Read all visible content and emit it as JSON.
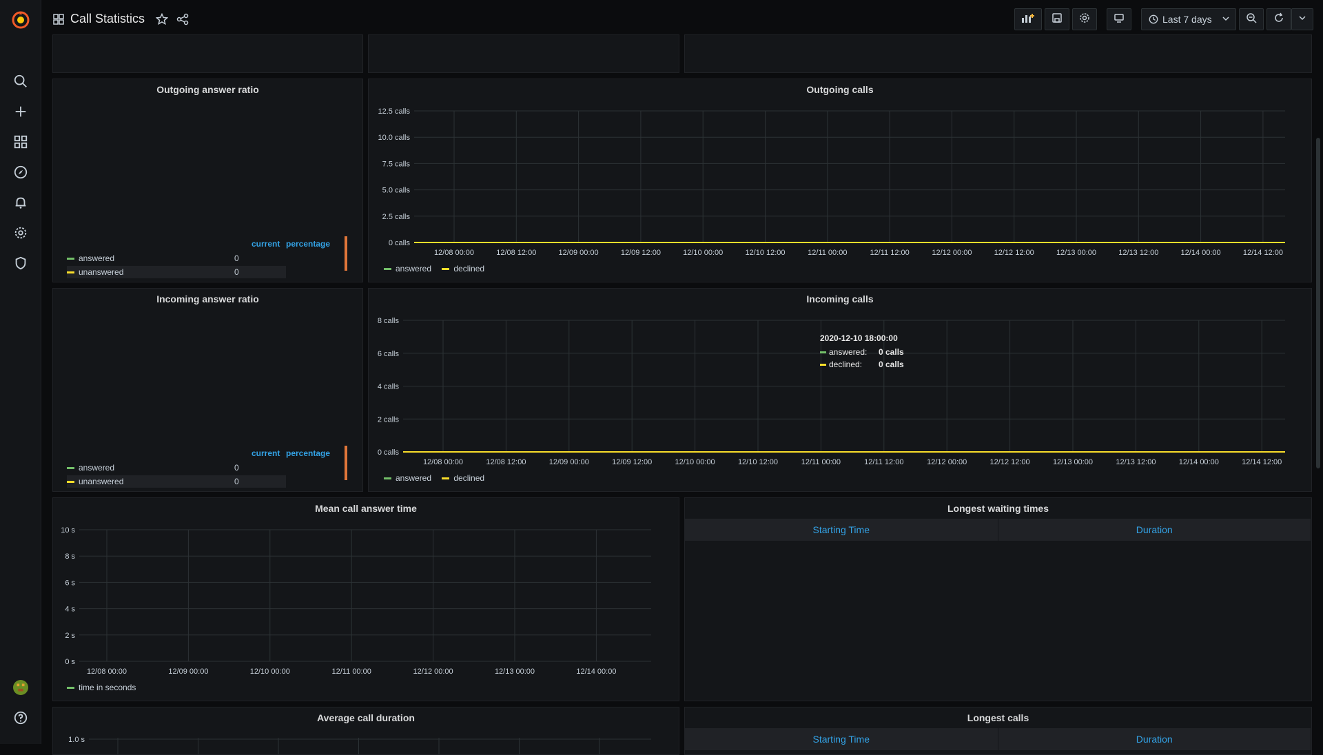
{
  "dashboard": {
    "title": "Call Statistics"
  },
  "topbar": {
    "time_range": "Last 7 days"
  },
  "colors": {
    "answered": "#73bf69",
    "declined": "#fade2a",
    "bar": "#e0763a",
    "accent": "#33a2e5"
  },
  "icons": {
    "sidemenu": [
      "grafana-logo",
      "search-icon",
      "plus-icon",
      "dashboards-icon",
      "explore-icon",
      "alerting-icon",
      "configuration-icon",
      "shield-icon",
      "user-avatar",
      "help-icon"
    ],
    "topbar": [
      "add-panel-icon",
      "save-icon",
      "settings-icon",
      "tv-mode-icon",
      "clock-icon",
      "zoom-out-icon",
      "refresh-icon",
      "chevron-down-icon"
    ]
  },
  "panels": {
    "outgoing_ratio": {
      "title": "Outgoing answer ratio",
      "columns": [
        "current",
        "percentage"
      ],
      "rows": [
        {
          "label": "answered",
          "current": "0"
        },
        {
          "label": "unanswered",
          "current": "0"
        }
      ]
    },
    "incoming_ratio": {
      "title": "Incoming answer ratio",
      "columns": [
        "current",
        "percentage"
      ],
      "rows": [
        {
          "label": "answered",
          "current": "0"
        },
        {
          "label": "unanswered",
          "current": "0"
        }
      ]
    },
    "longest_waiting": {
      "title": "Longest waiting times",
      "columns": [
        "Starting Time",
        "Duration"
      ]
    },
    "longest_calls": {
      "title": "Longest calls",
      "columns": [
        "Starting Time",
        "Duration"
      ]
    },
    "incoming_tooltip": {
      "time": "2020-12-10 18:00:00",
      "rows": [
        {
          "label": "answered:",
          "value": "0 calls"
        },
        {
          "label": "declined:",
          "value": "0 calls"
        }
      ]
    }
  },
  "chart_data": [
    {
      "id": "outgoing_calls",
      "type": "line",
      "title": "Outgoing calls",
      "x": [
        "12/08 00:00",
        "12/08 12:00",
        "12/09 00:00",
        "12/09 12:00",
        "12/10 00:00",
        "12/10 12:00",
        "12/11 00:00",
        "12/11 12:00",
        "12/12 00:00",
        "12/12 12:00",
        "12/13 00:00",
        "12/13 12:00",
        "12/14 00:00",
        "12/14 12:00"
      ],
      "y_ticks": [
        "0 calls",
        "2.5 calls",
        "5.0 calls",
        "7.5 calls",
        "10.0 calls",
        "12.5 calls"
      ],
      "ylim": [
        0,
        12.5
      ],
      "ylabel": "",
      "xlabel": "",
      "grid": true,
      "legend": "bottom-left",
      "series": [
        {
          "name": "answered",
          "values": [
            0,
            0,
            0,
            0,
            0,
            0,
            0,
            0,
            0,
            0,
            0,
            0,
            0,
            0
          ]
        },
        {
          "name": "declined",
          "values": [
            0,
            0,
            0,
            0,
            0,
            0,
            0,
            0,
            0,
            0,
            0,
            0,
            0,
            0
          ]
        }
      ]
    },
    {
      "id": "incoming_calls",
      "type": "line",
      "title": "Incoming calls",
      "x": [
        "12/08 00:00",
        "12/08 12:00",
        "12/09 00:00",
        "12/09 12:00",
        "12/10 00:00",
        "12/10 12:00",
        "12/11 00:00",
        "12/11 12:00",
        "12/12 00:00",
        "12/12 12:00",
        "12/13 00:00",
        "12/13 12:00",
        "12/14 00:00",
        "12/14 12:00"
      ],
      "y_ticks": [
        "0 calls",
        "2 calls",
        "4 calls",
        "6 calls",
        "8 calls"
      ],
      "ylim": [
        0,
        8
      ],
      "ylabel": "",
      "xlabel": "",
      "grid": true,
      "legend": "bottom-left",
      "series": [
        {
          "name": "answered",
          "values": [
            0,
            0,
            0,
            0,
            0,
            0,
            0,
            0,
            0,
            0,
            0,
            0,
            0,
            0
          ]
        },
        {
          "name": "declined",
          "values": [
            0,
            0,
            0,
            0,
            0,
            0,
            0,
            0,
            0,
            0,
            0,
            0,
            0,
            0
          ]
        }
      ]
    },
    {
      "id": "mean_answer_time",
      "type": "line",
      "title": "Mean call answer time",
      "x": [
        "12/08 00:00",
        "12/09 00:00",
        "12/10 00:00",
        "12/11 00:00",
        "12/12 00:00",
        "12/13 00:00",
        "12/14 00:00"
      ],
      "y_ticks": [
        "0 s",
        "2 s",
        "4 s",
        "6 s",
        "8 s",
        "10 s"
      ],
      "ylim": [
        0,
        10
      ],
      "ylabel": "",
      "xlabel": "",
      "grid": true,
      "legend": "bottom-left",
      "series": [
        {
          "name": "time in seconds",
          "values": []
        }
      ]
    },
    {
      "id": "avg_call_duration",
      "type": "line",
      "title": "Average call duration",
      "x": [],
      "y_ticks": [
        "1.0 s"
      ],
      "ylim": [
        0,
        1.0
      ],
      "ylabel": "",
      "xlabel": "",
      "grid": true,
      "series": []
    }
  ]
}
